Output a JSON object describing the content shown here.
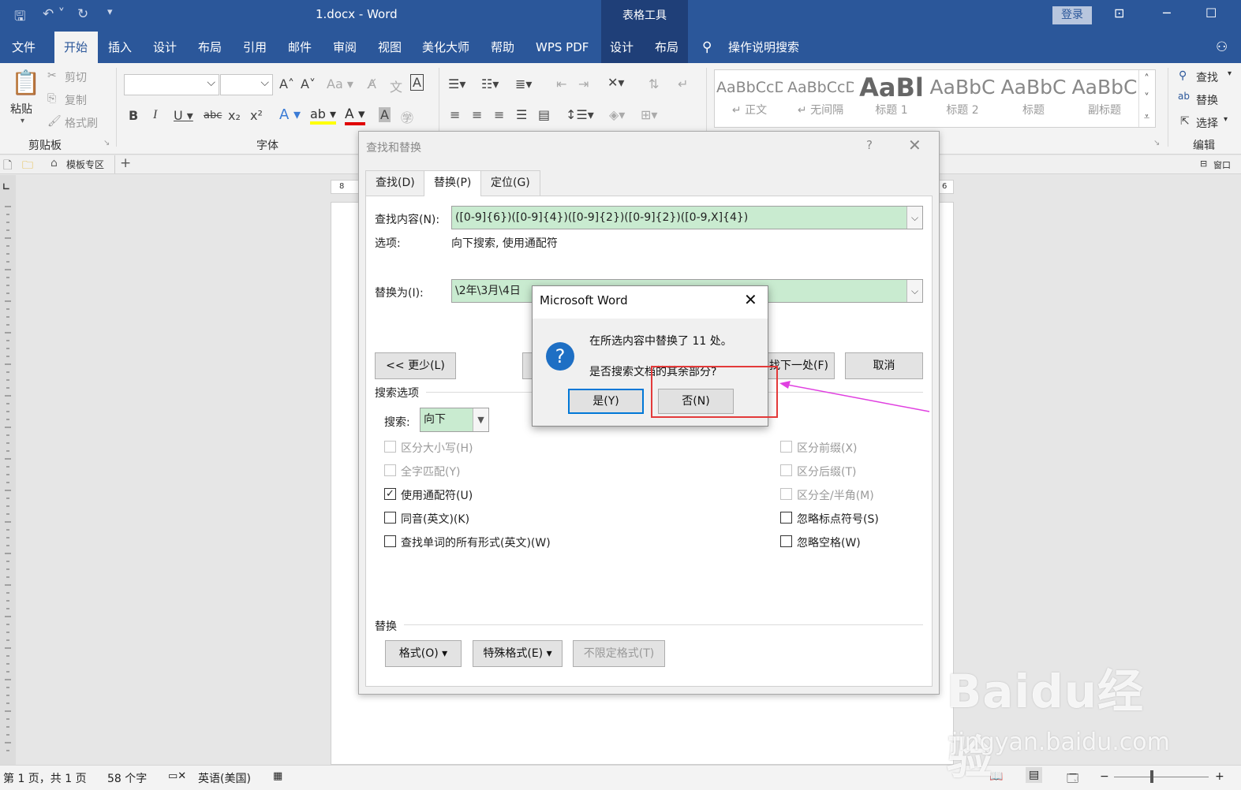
{
  "titlebar": {
    "doc_title": "1.docx  -  Word",
    "context_group": "表格工具",
    "login": "登录"
  },
  "tabs": [
    "文件",
    "开始",
    "插入",
    "设计",
    "布局",
    "引用",
    "邮件",
    "审阅",
    "视图",
    "美化大师",
    "帮助",
    "WPS PDF",
    "设计",
    "布局"
  ],
  "tell_me": "操作说明搜索",
  "ribbon": {
    "clipboard": {
      "paste": "粘贴",
      "cut": "剪切",
      "copy": "复制",
      "format_painter": "格式刷",
      "label": "剪贴板"
    },
    "font": {
      "label": "字体"
    },
    "styles": [
      {
        "sample": "AaBbCcDc",
        "name": "↵ 正文"
      },
      {
        "sample": "AaBbCcDc",
        "name": "↵ 无间隔"
      },
      {
        "sample": "AaBl",
        "name": "标题 1"
      },
      {
        "sample": "AaBbC",
        "name": "标题 2"
      },
      {
        "sample": "AaBbC",
        "name": "标题"
      },
      {
        "sample": "AaBbC",
        "name": "副标题"
      }
    ],
    "editing": {
      "find": "查找",
      "replace": "替换",
      "select": "选择",
      "label": "编辑"
    }
  },
  "quickbar": {
    "template_zone": "模板专区",
    "window": "窗口"
  },
  "find_replace": {
    "title": "查找和替换",
    "tabs": [
      "查找(D)",
      "替换(P)",
      "定位(G)"
    ],
    "find_label": "查找内容(N):",
    "find_value": "([0-9]{6})([0-9]{4})([0-9]{2})([0-9]{2})([0-9,X]{4})",
    "options_label": "选项:",
    "options_value": "向下搜索, 使用通配符",
    "replace_label": "替换为(I):",
    "replace_value": "\\2年\\3月\\4日",
    "less_button": "<< 更少(L)",
    "find_next_button": "查找下一处(F)",
    "cancel_button": "取消",
    "search_options_title": "搜索选项",
    "search_label": "搜索:",
    "search_value": "向下",
    "checkboxes_left": [
      {
        "label": "区分大小写(H)",
        "checked": false,
        "disabled": true
      },
      {
        "label": "全字匹配(Y)",
        "checked": false,
        "disabled": true
      },
      {
        "label": "使用通配符(U)",
        "checked": true,
        "disabled": false
      },
      {
        "label": "同音(英文)(K)",
        "checked": false,
        "disabled": false
      },
      {
        "label": "查找单词的所有形式(英文)(W)",
        "checked": false,
        "disabled": false
      }
    ],
    "checkboxes_right": [
      {
        "label": "区分前缀(X)",
        "checked": false,
        "disabled": true
      },
      {
        "label": "区分后缀(T)",
        "checked": false,
        "disabled": true
      },
      {
        "label": "区分全/半角(M)",
        "checked": false,
        "disabled": true
      },
      {
        "label": "忽略标点符号(S)",
        "checked": false,
        "disabled": false
      },
      {
        "label": "忽略空格(W)",
        "checked": false,
        "disabled": false
      }
    ],
    "replace_section_title": "替换",
    "format_button": "格式(O) ▾",
    "special_button": "特殊格式(E) ▾",
    "no_format_button": "不限定格式(T)"
  },
  "msgbox": {
    "title": "Microsoft Word",
    "line1": "在所选内容中替换了 11 处。",
    "line2": "是否搜索文档的其余部分?",
    "yes_button": "是(Y)",
    "no_button": "否(N)"
  },
  "ruler_h_left": "8",
  "ruler_h_right": "6",
  "status": {
    "page": "第 1 页，共 1 页",
    "words": "58 个字",
    "language": "英语(美国)"
  },
  "watermark": {
    "brand": "Baidu经验",
    "url": "jingyan.baidu.com"
  },
  "colors": {
    "accent": "#2b579a",
    "highlight": "#e33a3a",
    "arrow": "#e040e0",
    "field_bg": "#c9ebd0"
  }
}
